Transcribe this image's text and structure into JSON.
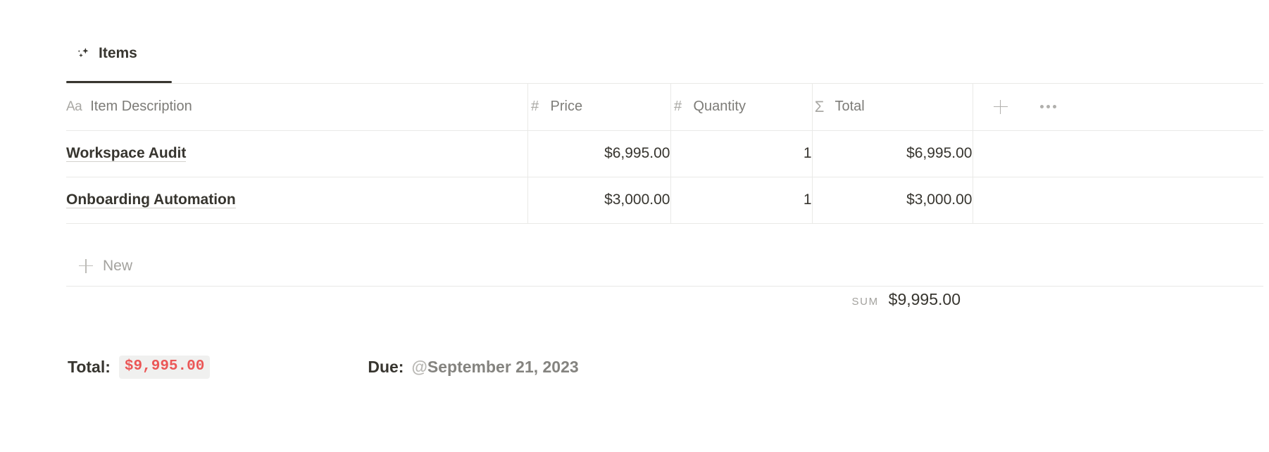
{
  "tabs": [
    {
      "label": "Items",
      "icon": "sparkle-icon",
      "active": true
    }
  ],
  "table": {
    "columns": [
      {
        "label": "Item Description",
        "icon": "text-type-icon",
        "icon_glyph": "Aa"
      },
      {
        "label": "Price",
        "icon": "number-type-icon",
        "icon_glyph": "#"
      },
      {
        "label": "Quantity",
        "icon": "number-type-icon",
        "icon_glyph": "#"
      },
      {
        "label": "Total",
        "icon": "formula-sigma-icon",
        "icon_glyph": "Σ"
      }
    ],
    "header_actions": {
      "add_column": "add-column-icon",
      "more_options": "more-options-icon"
    },
    "rows": [
      {
        "description": "Workspace Audit",
        "price": "$6,995.00",
        "quantity": "1",
        "total": "$6,995.00"
      },
      {
        "description": "Onboarding Automation",
        "price": "$3,000.00",
        "quantity": "1",
        "total": "$3,000.00"
      }
    ],
    "new_row_label": "New",
    "summary": {
      "label": "SUM",
      "value": "$9,995.00"
    }
  },
  "footer": {
    "total_label": "Total:",
    "total_value": "$9,995.00",
    "total_value_color": "#eb5757",
    "due_label": "Due:",
    "due_at": "@",
    "due_date": "September 21, 2023"
  }
}
